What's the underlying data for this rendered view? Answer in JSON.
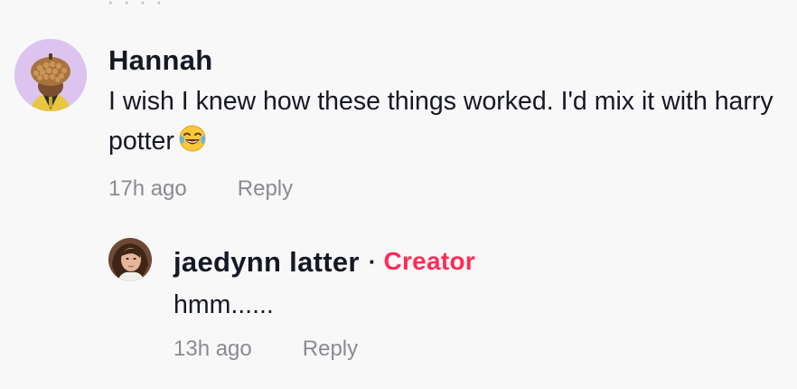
{
  "comments": [
    {
      "username": "Hannah",
      "text": "I wish I knew how these things worked. I'd mix it with harry potter",
      "emoji": "face-with-tears-of-joy-icon",
      "time": "17h ago",
      "reply_label": "Reply",
      "replies": [
        {
          "username": "jaedynn latter",
          "separator": "·",
          "badge": "Creator",
          "text": "hmm......",
          "time": "13h ago",
          "reply_label": "Reply"
        }
      ]
    }
  ],
  "colors": {
    "background": "#f8f8f8",
    "text": "#161823",
    "muted": "#8a8b91",
    "creator_badge": "#fe2c55",
    "avatar_bg": "#dcc4ef"
  }
}
